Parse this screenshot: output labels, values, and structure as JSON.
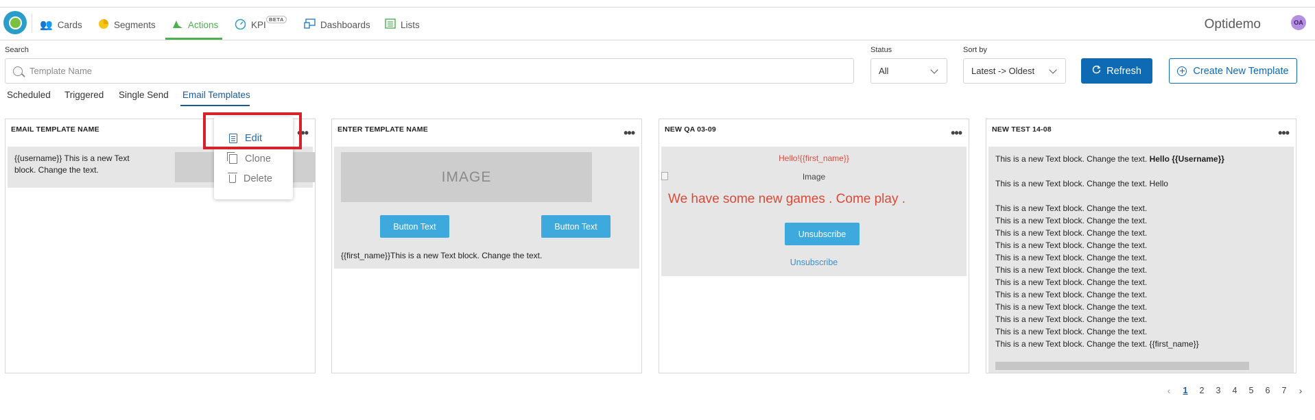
{
  "nav": {
    "items": [
      {
        "label": "Cards",
        "icon": "users-icon"
      },
      {
        "label": "Segments",
        "icon": "pie-chart-icon"
      },
      {
        "label": "Actions",
        "icon": "actions-icon"
      },
      {
        "label": "KPI",
        "icon": "gauge-icon"
      },
      {
        "label": "Dashboards",
        "icon": "dashboard-icon"
      },
      {
        "label": "Lists",
        "icon": "list-icon"
      }
    ],
    "active": "Actions",
    "beta_badge": "BETA",
    "brand": "Optidemo",
    "avatar_initials": "OA"
  },
  "filters": {
    "search_label": "Search",
    "search_placeholder": "Template Name",
    "status_label": "Status",
    "status_value": "All",
    "sort_label": "Sort by",
    "sort_value": "Latest -> Oldest",
    "refresh_label": "Refresh",
    "create_label": "Create New Template"
  },
  "tabs": [
    "Scheduled",
    "Triggered",
    "Single Send",
    "Email Templates"
  ],
  "active_tab": "Email Templates",
  "cards": [
    {
      "title": "EMAIL TEMPLATE NAME",
      "preview_text": "{{username}} This is a new Text block. Change the text."
    },
    {
      "title": "ENTER TEMPLATE NAME",
      "image_placeholder": "IMAGE",
      "button_1": "Button Text",
      "button_2": "Button Text",
      "preview_text": "{{first_name}}This is a new Text block. Change the text."
    },
    {
      "title": "NEW QA 03-09",
      "greeting": "Hello!{{first_name}}",
      "image_alt": "Image",
      "headline": "We have some new games . Come play .",
      "unsubscribe_button": "Unsubscribe",
      "unsubscribe_link": "Unsubscribe"
    },
    {
      "title": "NEW TEST 14-08",
      "line_1_prefix": "This is a new Text block. Change the text. ",
      "line_1_bold": "Hello {{Username}}",
      "line_2": "This is a new Text block. Change the text. Hello",
      "repeat_line": "This is a new Text block. Change the text.",
      "last_line": "This is a new Text block. Change the text. {{first_name}}"
    }
  ],
  "context_menu": {
    "items": [
      "Edit",
      "Clone",
      "Delete"
    ],
    "highlight_color": "#d6232b"
  },
  "pagination": {
    "pages": [
      "1",
      "2",
      "3",
      "4",
      "5",
      "6",
      "7"
    ],
    "current": "1",
    "prev": "‹",
    "next": "›"
  },
  "colors": {
    "accent_green": "#4caf50",
    "primary_blue": "#0f6ab4",
    "button_blue": "#3da9dd"
  }
}
